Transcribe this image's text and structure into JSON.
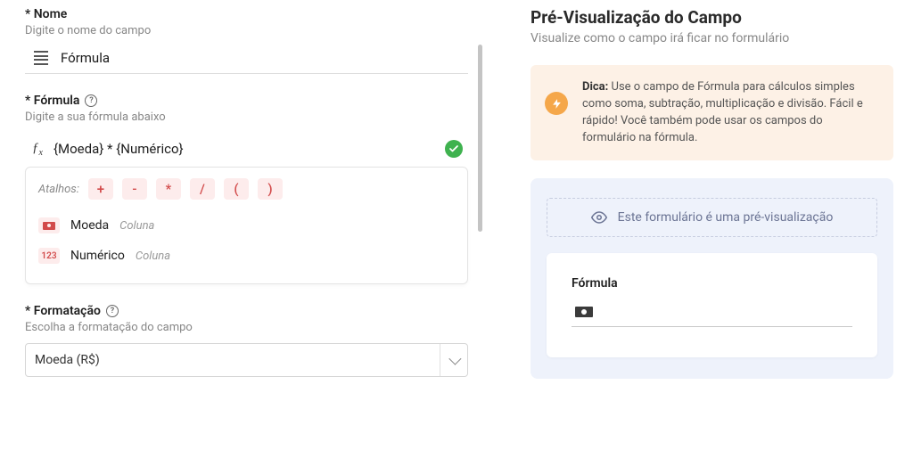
{
  "left": {
    "name_section": {
      "label": "* Nome",
      "hint": "Digite o nome do campo",
      "value": "Fórmula"
    },
    "formula_section": {
      "label": "* Fórmula",
      "hint": "Digite a sua fórmula abaixo",
      "fx_symbol": "ƒx",
      "value": "{Moeda} * {Numérico}",
      "valid": true
    },
    "suggestions": {
      "shortcuts_label": "Atalhos:",
      "operators": [
        "+",
        "-",
        "*",
        "/",
        "(",
        ")"
      ],
      "columns": [
        {
          "badge": "money",
          "name": "Moeda",
          "type": "Coluna"
        },
        {
          "badge": "123",
          "name": "Numérico",
          "type": "Coluna"
        }
      ]
    },
    "format_section": {
      "label": "* Formatação",
      "hint": "Escolha a formatação do campo",
      "selected": "Moeda (R$)"
    }
  },
  "right": {
    "title": "Pré-Visualização do Campo",
    "subtitle": "Visualize como o campo irá ficar no formulário",
    "tip": {
      "bold": "Dica:",
      "text": " Use o campo de Fórmula para cálculos simples como soma, subtração, multiplicação e divisão. Fácil e rápido! Você também pode usar os campos do formulário na fórmula."
    },
    "banner": "Este formulário é uma pré-visualização",
    "field_label": "Fórmula"
  }
}
